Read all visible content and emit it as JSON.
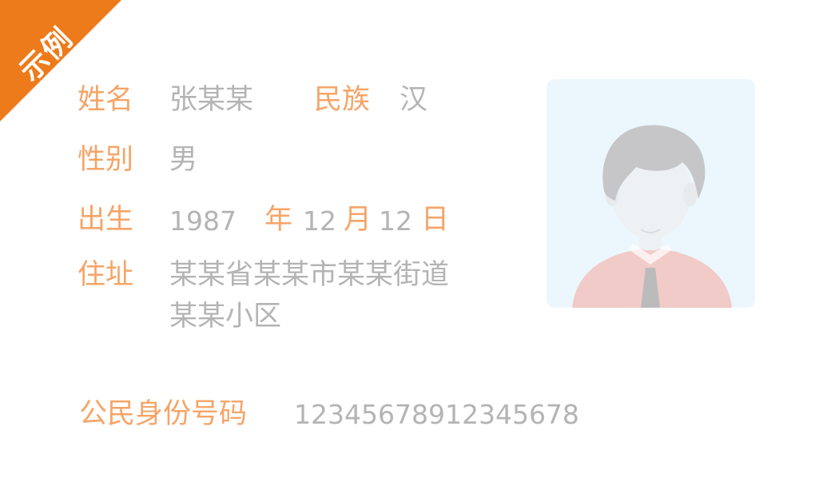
{
  "badge": {
    "text": "示例",
    "color": "#ee7b1b"
  },
  "colors": {
    "label": "#f6a467",
    "value": "#b4b4b4",
    "photo_bg": "#ecf7fd"
  },
  "name": {
    "label": "姓名",
    "value": "张某某"
  },
  "ethnicity": {
    "label": "民族",
    "value": "汉"
  },
  "gender": {
    "label": "性别",
    "value": "男"
  },
  "birth": {
    "label": "出生",
    "year": "1987",
    "year_unit": "年",
    "month": "12",
    "month_unit": "月",
    "day": "12",
    "day_unit": "日"
  },
  "address": {
    "label": "住址",
    "line1": "某某省某某市某某街道",
    "line2": "某某小区"
  },
  "id_number": {
    "label": "公民身份号码",
    "value": "12345678912345678"
  },
  "photo": {
    "icon": "person-avatar-icon"
  }
}
